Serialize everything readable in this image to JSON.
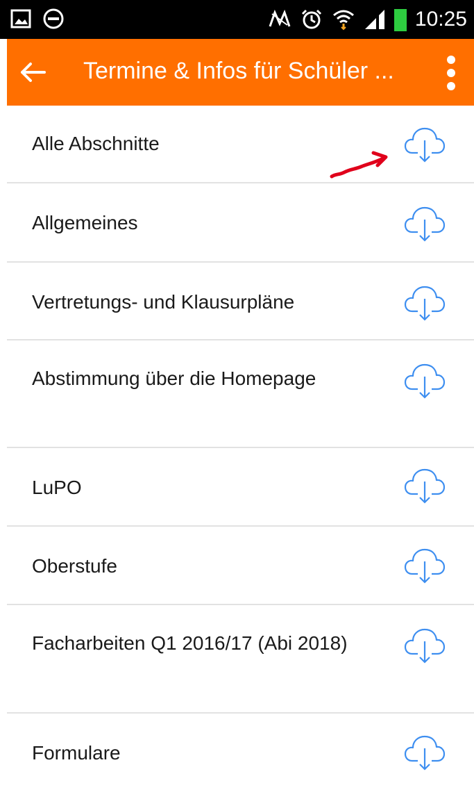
{
  "statusbar": {
    "time": "10:25",
    "left_icons": [
      "image-icon",
      "minus-circle-icon"
    ],
    "right_icons": [
      "nfc-icon",
      "alarm-icon",
      "wifi-icon",
      "signal-icon",
      "battery-icon"
    ]
  },
  "appbar": {
    "title": "Termine & Infos für Schüler ...",
    "color": "#ff6f00"
  },
  "list": {
    "items": [
      {
        "label": "Alle Abschnitte",
        "icon": "cloud-download-icon"
      },
      {
        "label": "Allgemeines",
        "icon": "cloud-download-icon"
      },
      {
        "label": "Vertretungs- und Klausurpläne",
        "icon": "cloud-download-icon"
      },
      {
        "label": "Abstimmung über die Homepage",
        "icon": "cloud-download-icon"
      },
      {
        "label": "LuPO",
        "icon": "cloud-download-icon"
      },
      {
        "label": "Oberstufe",
        "icon": "cloud-download-icon"
      },
      {
        "label": "Facharbeiten Q1 2016/17 (Abi 2018)",
        "icon": "cloud-download-icon"
      },
      {
        "label": "Formulare",
        "icon": "cloud-download-icon"
      }
    ]
  },
  "colors": {
    "accent": "#ff6f00",
    "icon_blue": "#3d8ef0",
    "annotation_red": "#e0001b"
  }
}
